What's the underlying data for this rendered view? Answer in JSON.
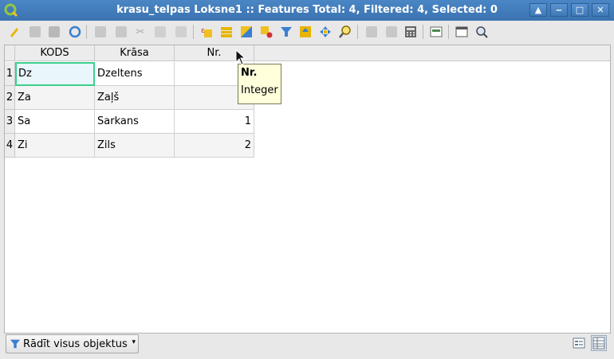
{
  "window": {
    "title": "krasu_telpas Loksne1 :: Features Total: 4, Filtered: 4, Selected: 0",
    "controls": [
      "up-arrow-icon",
      "minimize-icon",
      "maximize-icon",
      "close-icon"
    ]
  },
  "toolbar": {
    "buttons": [
      {
        "name": "toggle-editing-icon",
        "color": "#e8b400",
        "enabled": true
      },
      {
        "name": "toggle-multi-edit-icon",
        "color": "#a0a0a0",
        "enabled": false
      },
      {
        "name": "save-edits-icon",
        "color": "#a0a0a0",
        "enabled": false
      },
      {
        "name": "reload-icon",
        "color": "#3a7fd0",
        "enabled": true
      },
      {
        "name": "add-feature-icon",
        "color": "#a0a0a0",
        "enabled": false
      },
      {
        "name": "delete-feature-icon",
        "color": "#a0a0a0",
        "enabled": false
      },
      {
        "name": "cut-icon",
        "color": "#a0a0a0",
        "enabled": false
      },
      {
        "name": "copy-icon",
        "color": "#a0a0a0",
        "enabled": false
      },
      {
        "name": "paste-icon",
        "color": "#a0a0a0",
        "enabled": false
      },
      {
        "name": "select-by-expression-icon",
        "color": "#e8b400",
        "enabled": true
      },
      {
        "name": "select-all-icon",
        "color": "#e8b400",
        "enabled": true
      },
      {
        "name": "invert-selection-icon",
        "color": "#e8b400",
        "enabled": true
      },
      {
        "name": "deselect-all-icon",
        "color": "#e8b400",
        "enabled": true
      },
      {
        "name": "filter-select-icon",
        "color": "#3a7fd0",
        "enabled": true
      },
      {
        "name": "move-selection-top-icon",
        "color": "#e8b400",
        "enabled": true
      },
      {
        "name": "pan-to-selected-icon",
        "color": "#3a7fd0",
        "enabled": true
      },
      {
        "name": "zoom-to-selected-icon",
        "color": "#e8b400",
        "enabled": true
      },
      {
        "name": "new-field-icon",
        "color": "#a0a0a0",
        "enabled": false
      },
      {
        "name": "delete-field-icon",
        "color": "#a0a0a0",
        "enabled": false
      },
      {
        "name": "field-calculator-icon",
        "color": "#555555",
        "enabled": true
      },
      {
        "name": "conditional-formatting-icon",
        "color": "#4a8a4a",
        "enabled": true
      },
      {
        "name": "dock-table-icon",
        "color": "#555555",
        "enabled": true
      },
      {
        "name": "actions-icon",
        "color": "#555555",
        "enabled": true
      }
    ]
  },
  "table": {
    "columns": [
      "KODS",
      "Krāsa",
      "Nr."
    ],
    "rows": [
      {
        "num": "1",
        "cells": [
          "Dz",
          "Dzeltens",
          ""
        ]
      },
      {
        "num": "2",
        "cells": [
          "Za",
          "Zaļš",
          ""
        ]
      },
      {
        "num": "3",
        "cells": [
          "Sa",
          "Sarkans",
          "1"
        ]
      },
      {
        "num": "4",
        "cells": [
          "Zi",
          "Zils",
          "2"
        ]
      }
    ]
  },
  "tooltip": {
    "title": "Nr.",
    "type": "Integer"
  },
  "statusbar": {
    "filter_label": "Rādīt visus objektus",
    "view_buttons": [
      "form-view-icon",
      "table-view-icon"
    ]
  }
}
